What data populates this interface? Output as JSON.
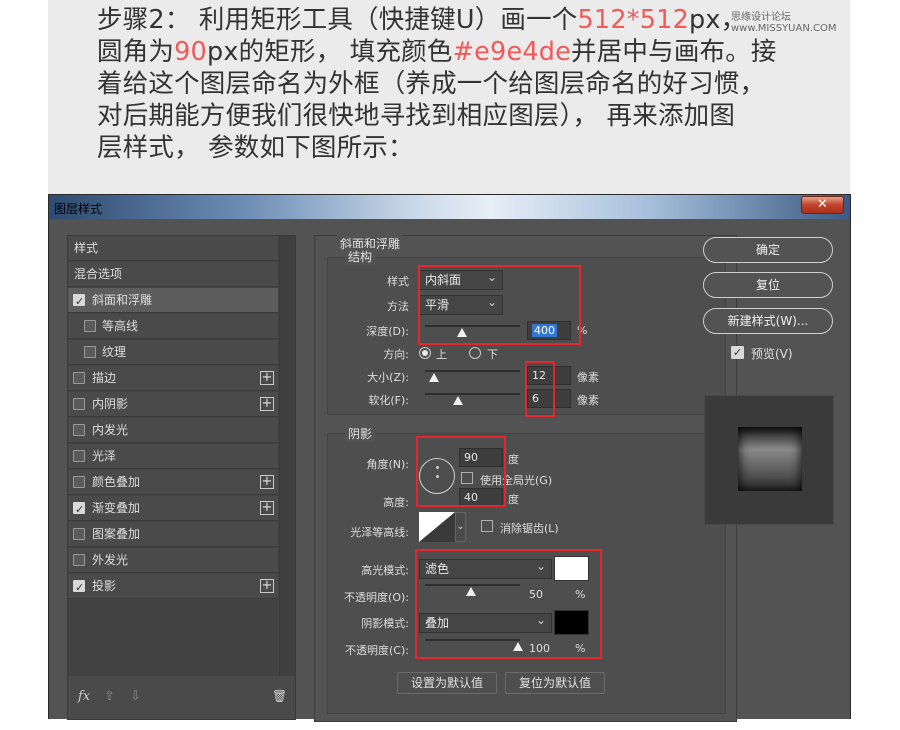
{
  "tutorial": {
    "line1_a": "步骤2：  利用矩形工具（快捷键U）画一个",
    "line1_hl": "512*512",
    "line1_b": "px，",
    "line2_a": "圆角为",
    "line2_hl1": "90",
    "line2_b": "px的矩形，  填充颜色",
    "line2_hl2": "#e9e4de",
    "line2_c": "并居中与画布。接",
    "line3": "着给这个图层命名为外框（养成一个给图层命名的好习惯，",
    "line4": "对后期能方便我们很快地寻找到相应图层），  再来添加图",
    "line5": "层样式，  参数如下图所示：",
    "watermark": "思缘设计论坛  www.MISSYUAN.COM"
  },
  "dialog": {
    "title": "图层样式",
    "close": "✕"
  },
  "left_panel": {
    "items": [
      {
        "label": "样式",
        "checkbox": false,
        "checked": false,
        "plus": false,
        "indent": false
      },
      {
        "label": "混合选项",
        "checkbox": false,
        "checked": false,
        "plus": false,
        "indent": false
      },
      {
        "label": "斜面和浮雕",
        "checkbox": true,
        "checked": true,
        "plus": false,
        "indent": false,
        "selected": true
      },
      {
        "label": "等高线",
        "checkbox": true,
        "checked": false,
        "plus": false,
        "indent": true
      },
      {
        "label": "纹理",
        "checkbox": true,
        "checked": false,
        "plus": false,
        "indent": true
      },
      {
        "label": "描边",
        "checkbox": true,
        "checked": false,
        "plus": true,
        "indent": false
      },
      {
        "label": "内阴影",
        "checkbox": true,
        "checked": false,
        "plus": true,
        "indent": false
      },
      {
        "label": "内发光",
        "checkbox": true,
        "checked": false,
        "plus": false,
        "indent": false
      },
      {
        "label": "光泽",
        "checkbox": true,
        "checked": false,
        "plus": false,
        "indent": false
      },
      {
        "label": "颜色叠加",
        "checkbox": true,
        "checked": false,
        "plus": true,
        "indent": false
      },
      {
        "label": "渐变叠加",
        "checkbox": true,
        "checked": true,
        "plus": true,
        "indent": false
      },
      {
        "label": "图案叠加",
        "checkbox": true,
        "checked": false,
        "plus": false,
        "indent": false
      },
      {
        "label": "外发光",
        "checkbox": true,
        "checked": false,
        "plus": false,
        "indent": false
      },
      {
        "label": "投影",
        "checkbox": true,
        "checked": true,
        "plus": true,
        "indent": false
      }
    ],
    "footer": {
      "fx": "fx",
      "up": "⇧",
      "down": "⇩",
      "trash": "🗑"
    }
  },
  "bevel": {
    "section_title": "斜面和浮雕",
    "structure_title": "结构",
    "style_label": "样式",
    "style_value": "内斜面",
    "technique_label": "方法",
    "technique_value": "平滑",
    "depth_label": "深度(D):",
    "depth_value": "400",
    "depth_unit": "%",
    "direction_label": "方向:",
    "direction_up": "上",
    "direction_down": "下",
    "size_label": "大小(Z):",
    "size_value": "12",
    "size_unit": "像素",
    "soften_label": "软化(F):",
    "soften_value": "6",
    "soften_unit": "像素"
  },
  "shading": {
    "title": "阴影",
    "angle_label": "角度(N):",
    "angle_value": "90",
    "angle_unit": "度",
    "global_light_label": "使用全局光(G)",
    "altitude_label": "高度:",
    "altitude_value": "40",
    "altitude_unit": "度",
    "gloss_label": "光泽等高线:",
    "anti_alias_label": "消除锯齿(L)",
    "highlight_mode_label": "高光模式:",
    "highlight_mode_value": "滤色",
    "highlight_color": "#ffffff",
    "highlight_opacity_label": "不透明度(O):",
    "highlight_opacity_value": "50",
    "shadow_mode_label": "阴影模式:",
    "shadow_mode_value": "叠加",
    "shadow_color": "#000000",
    "shadow_opacity_label": "不透明度(C):",
    "shadow_opacity_value": "100",
    "pct": "%",
    "make_default": "设置为默认值",
    "reset_default": "复位为默认值"
  },
  "right_panel": {
    "ok": "确定",
    "reset": "复位",
    "new_style": "新建样式(W)...",
    "preview_label": "预览(V)"
  }
}
